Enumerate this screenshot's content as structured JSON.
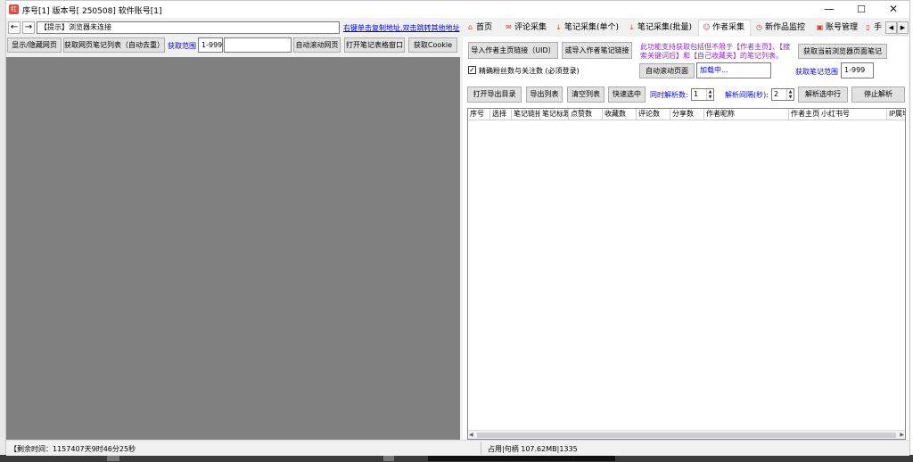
{
  "window": {
    "title": "序号[1] 版本号[ 250508] 软件账号[1]",
    "app_icon": "红"
  },
  "left": {
    "back_label": "←",
    "forward_label": "→",
    "address_value": "【提示】浏览器未连接",
    "address_hint": "右键单击复制地址,双击跳转其他地址",
    "btn_toggle": "显示/隐藏网页",
    "btn_fetch_list": "获取网页笔记列表（自动去重）",
    "range_link": "获取范围",
    "range_value": "1-999",
    "btn_auto_scroll": "自动滚动网页",
    "btn_open_window": "打开笔记表格窗口",
    "btn_cookie": "获取Cookie"
  },
  "tabs": [
    {
      "label": "首页",
      "icon": "home-icon",
      "glyph": "⌂",
      "active": false
    },
    {
      "label": "评论采集",
      "icon": "comment-icon",
      "glyph": "✉",
      "active": false
    },
    {
      "label": "笔记采集(单个)",
      "icon": "download-icon",
      "glyph": "⤓",
      "active": false
    },
    {
      "label": "笔记采集(批量)",
      "icon": "download-icon",
      "glyph": "⤓",
      "active": false
    },
    {
      "label": "作者采集",
      "icon": "author-icon",
      "glyph": "☺",
      "active": true
    },
    {
      "label": "新作品监控",
      "icon": "clock-icon",
      "glyph": "◷",
      "active": false
    },
    {
      "label": "账号管理",
      "icon": "account-icon",
      "glyph": "▣",
      "active": false
    },
    {
      "label": "手",
      "icon": "phone-icon",
      "glyph": "▯",
      "active": false
    }
  ],
  "author": {
    "btn_import_uid": "导入作者主页链接（UID）",
    "btn_import_note": "或导入作者笔记链接",
    "notice": "此功能支持获取包括但不限于【作者主页】、【搜索关键词后】和【自己收藏夹】的笔记列表。",
    "btn_fetch_current": "获取当前浏览器页面笔记",
    "checkbox_label": "精确粉丝数与关注数 (必须登录)",
    "btn_auto_scroll": "自动滚动页面",
    "loading_text": "加载中...",
    "range_link": "获取笔记范围",
    "range_value": "1-999",
    "btn_open_dir": "打开导出目录",
    "btn_export": "导出列表",
    "btn_clear": "清空列表",
    "btn_quick_select": "快速选中",
    "threads_label": "同时解析数:",
    "threads_value": "1",
    "interval_label": "解析间隔(秒):",
    "interval_value": "2",
    "btn_parse_selected": "解析选中行",
    "btn_stop": "停止解析"
  },
  "grid": {
    "columns": [
      "序号",
      "选择",
      "笔记链接",
      "笔记标题",
      "点赞数",
      "收藏数",
      "评论数",
      "分享数",
      "作者昵称",
      "作者主页",
      "小红书号",
      "IP属地"
    ]
  },
  "status": {
    "left": "【剩余时间：1157407天9时46分25秒",
    "right": "占用|句柄 107.62MB|1335"
  }
}
